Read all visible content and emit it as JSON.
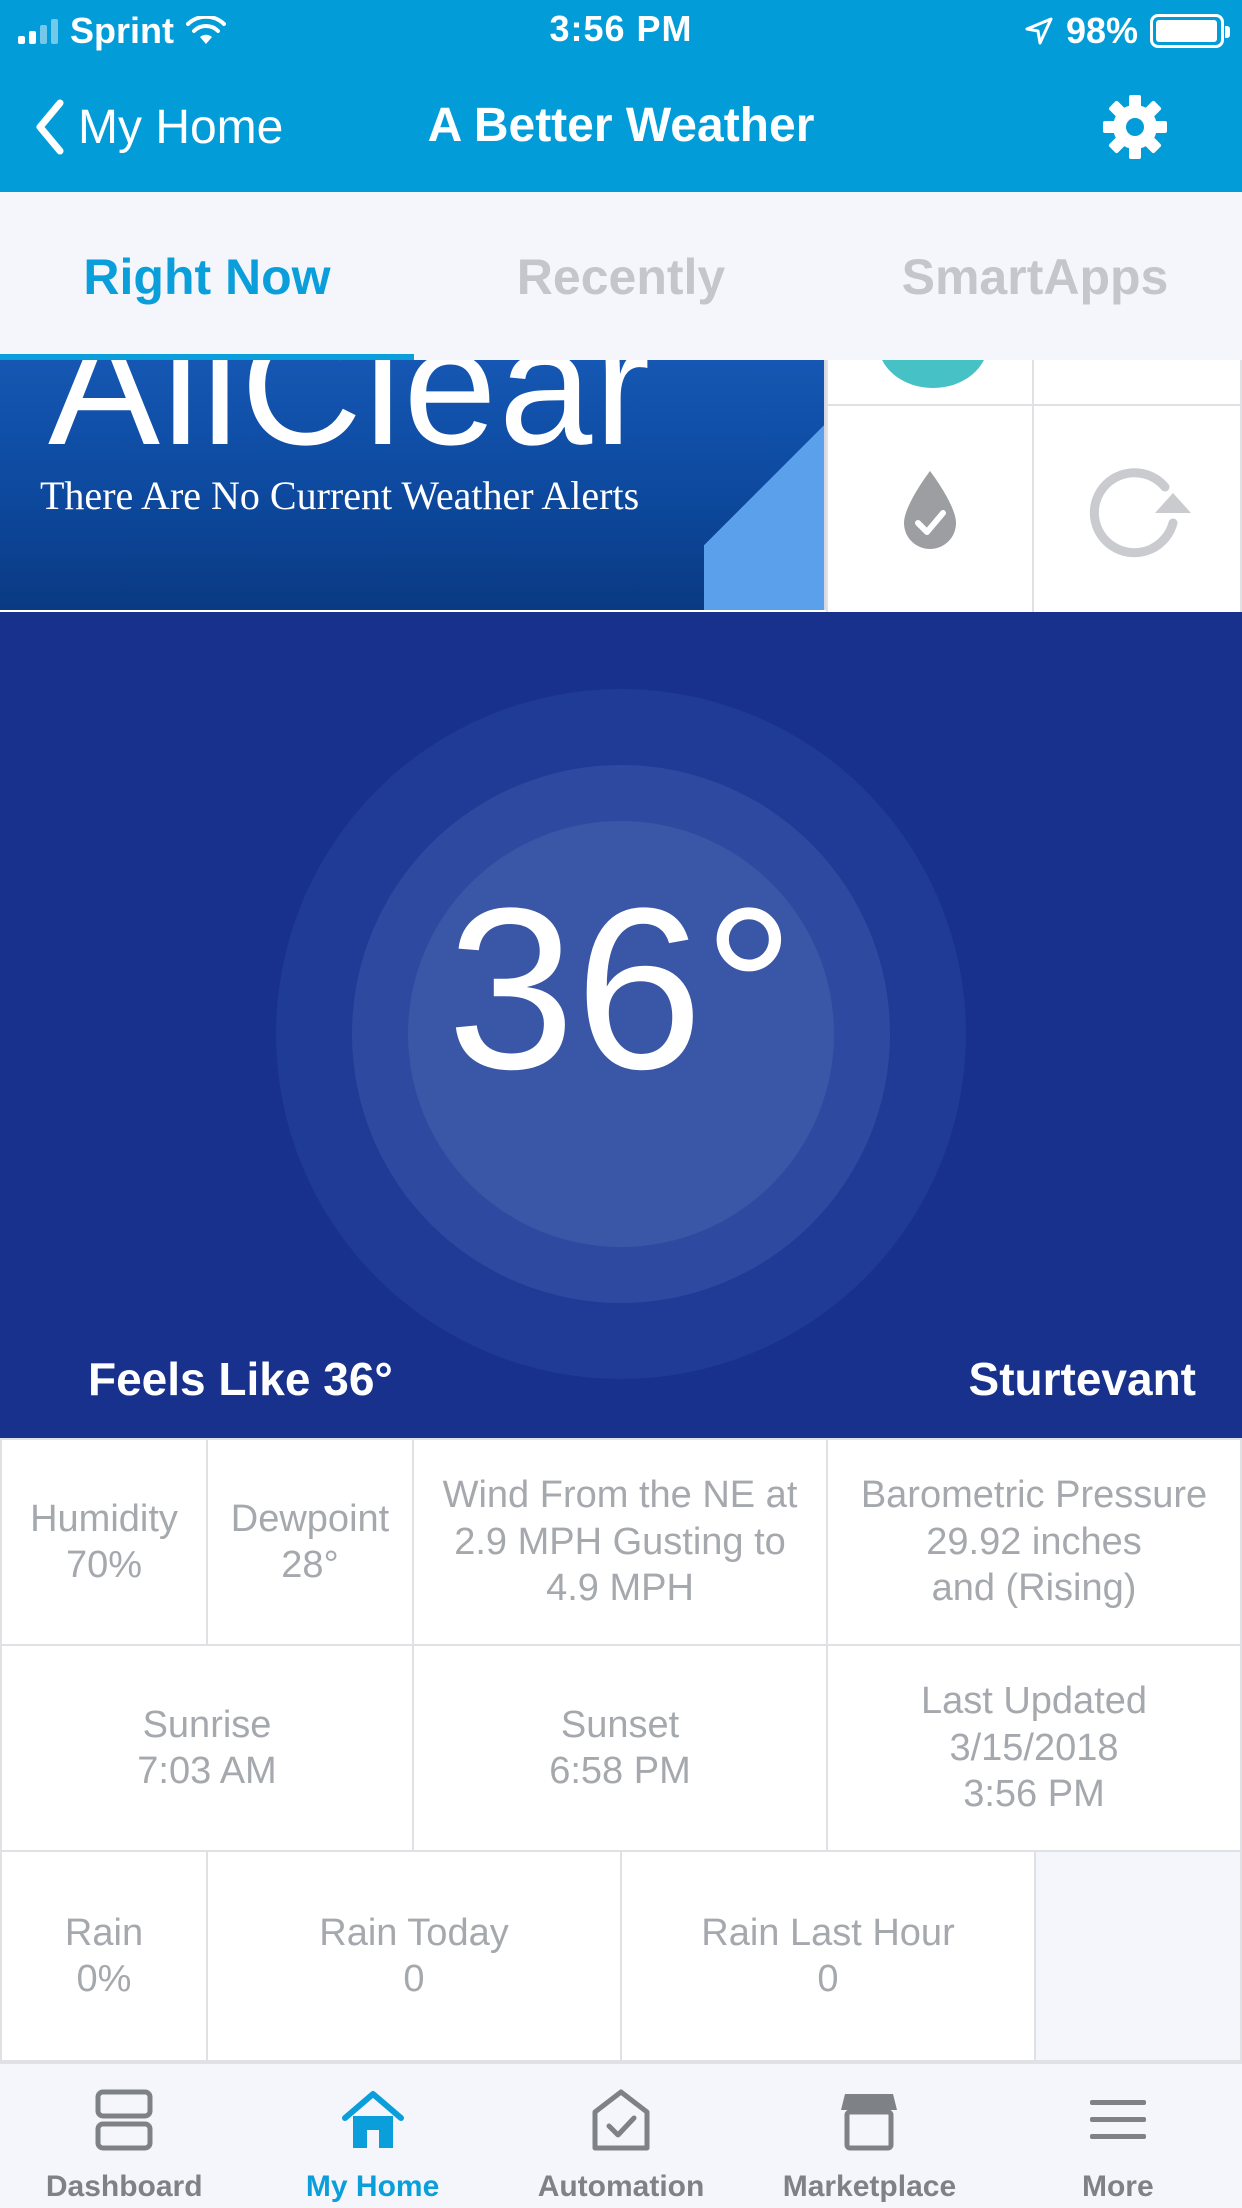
{
  "status_bar": {
    "carrier": "Sprint",
    "time": "3:56 PM",
    "battery_text": "98%",
    "battery_level": 0.98
  },
  "nav": {
    "back_label": "My Home",
    "title": "A Better Weather",
    "settings_icon": "gear-icon"
  },
  "tabs": [
    {
      "label": "Right Now",
      "active": true
    },
    {
      "label": "Recently",
      "active": false
    },
    {
      "label": "SmartApps",
      "active": false
    }
  ],
  "alert": {
    "headline": "AllClear",
    "message": "There Are No Current Weather Alerts"
  },
  "tiles": {
    "rain_check_icon": "water-drop-check-icon",
    "refresh_icon": "refresh-icon"
  },
  "current": {
    "temperature": "36°",
    "feels_like": "Feels Like 36°",
    "location": "Sturtevant"
  },
  "details": {
    "humidity": {
      "label": "Humidity",
      "value": "70%"
    },
    "dewpoint": {
      "label": "Dewpoint",
      "value": "28°"
    },
    "wind": {
      "line1": "Wind From the NE at",
      "line2": "2.9 MPH Gusting to",
      "line3": "4.9 MPH"
    },
    "pressure": {
      "line1": "Barometric Pressure",
      "line2": "29.92 inches",
      "line3": "and (Rising)"
    },
    "sunrise": {
      "label": "Sunrise",
      "value": "7:03 AM"
    },
    "sunset": {
      "label": "Sunset",
      "value": "6:58 PM"
    },
    "last_updated": {
      "label": "Last Updated",
      "date": "3/15/2018",
      "time": "3:56 PM"
    },
    "rain": {
      "label": "Rain",
      "value": "0%"
    },
    "rain_today": {
      "label": "Rain Today",
      "value": "0"
    },
    "rain_last_hour": {
      "label": "Rain Last Hour",
      "value": "0"
    }
  },
  "bottom_nav": [
    {
      "label": "Dashboard",
      "icon": "dashboard-icon",
      "active": false
    },
    {
      "label": "My Home",
      "icon": "home-icon",
      "active": true
    },
    {
      "label": "Automation",
      "icon": "automation-icon",
      "active": false
    },
    {
      "label": "Marketplace",
      "icon": "marketplace-icon",
      "active": false
    },
    {
      "label": "More",
      "icon": "menu-icon",
      "active": false
    }
  ],
  "colors": {
    "accent": "#029cd9",
    "temp_panel": "#17318d",
    "text_muted": "#a5a8ad"
  }
}
